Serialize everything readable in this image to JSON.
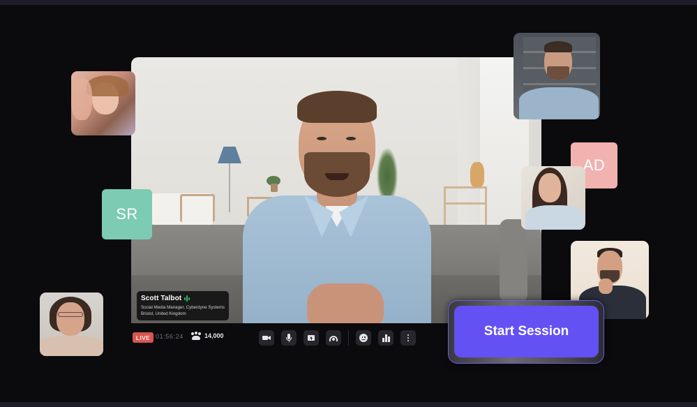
{
  "main_speaker": {
    "name": "Scott Talbot",
    "role": "Social Media Manager, Cyberdyne Systems",
    "location": "Bristol, United Kingdom",
    "speaking_indicator_icon": "audio-wave-icon",
    "speaking_indicator_color": "#31b86a"
  },
  "status": {
    "live_label": "LIVE",
    "live_color": "#d8554f",
    "elapsed_time": "01:56:24",
    "viewer_count": "14,000",
    "viewer_icon": "people-icon"
  },
  "toolbar": {
    "buttons": [
      {
        "name": "camera",
        "icon": "video-camera-icon"
      },
      {
        "name": "microphone",
        "icon": "microphone-icon"
      },
      {
        "name": "share-screen",
        "icon": "screen-share-icon"
      },
      {
        "name": "broadcast",
        "icon": "broadcast-icon"
      },
      {
        "name": "reactions",
        "icon": "smiley-icon"
      },
      {
        "name": "stats",
        "icon": "bar-chart-icon"
      },
      {
        "name": "more",
        "icon": "more-vertical-icon"
      }
    ]
  },
  "participants": [
    {
      "type": "photo",
      "description": "curly-haired woman waving"
    },
    {
      "type": "initials",
      "initials": "SR",
      "color": "#7ccbb2"
    },
    {
      "type": "photo",
      "description": "woman with glasses smiling"
    },
    {
      "type": "photo",
      "description": "bearded man in front of bookshelf"
    },
    {
      "type": "initials",
      "initials": "AD",
      "color": "#f1b2b0"
    },
    {
      "type": "photo",
      "description": "woman with long dark hair"
    },
    {
      "type": "photo",
      "description": "bearded man with hand on chin"
    }
  ],
  "cta": {
    "start_session_label": "Start Session",
    "accent_color": "#6351f4"
  }
}
